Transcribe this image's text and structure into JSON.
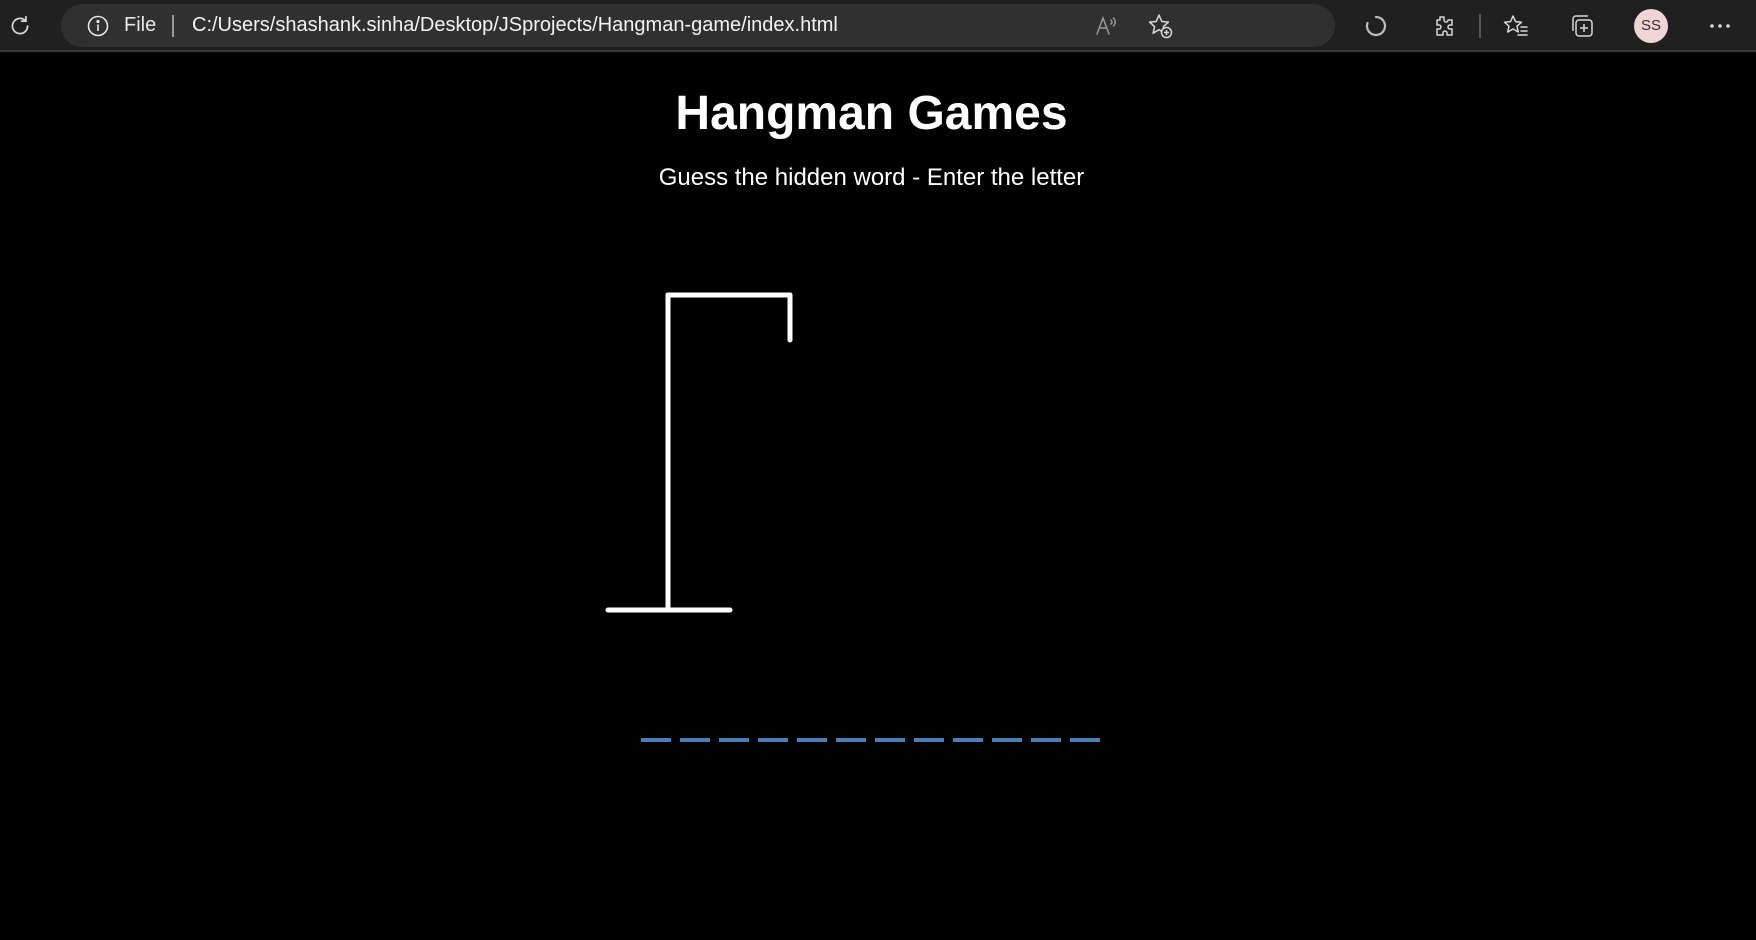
{
  "browser": {
    "address_scheme": "File",
    "url": "C:/Users/shashank.sinha/Desktop/JSprojects/Hangman-game/index.html",
    "profile_initials": "SS"
  },
  "page": {
    "title": "Hangman Games",
    "subtitle": "Guess the hidden word - Enter the letter"
  },
  "game": {
    "word_length": 12,
    "accent_color": "#4a7fb5"
  }
}
